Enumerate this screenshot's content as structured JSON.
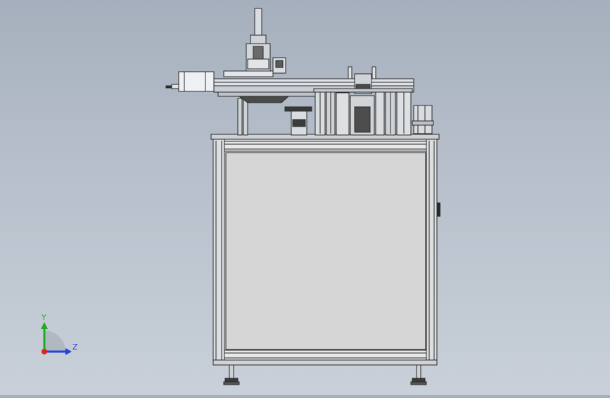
{
  "view": {
    "type": "CAD 3D model viewport",
    "background": "#b4bdc8"
  },
  "triad": {
    "y_label": "Y",
    "z_label": "Z",
    "y_color": "#22aa22",
    "z_color": "#2244dd",
    "x_color": "#dd2222"
  },
  "model": {
    "frame_color": "#d7dadd",
    "panel_color": "#d6d6d6",
    "line_color": "#2a2a2a",
    "motor_color": "#eef0f4"
  }
}
